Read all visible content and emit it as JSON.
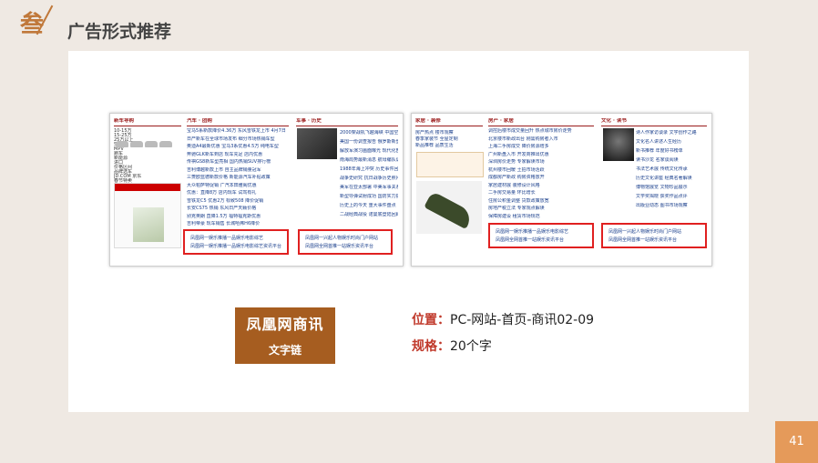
{
  "header": {
    "section_number": "叁",
    "section_title": "广告形式推荐"
  },
  "screenshot_left": {
    "col1_heading": "新车导购",
    "col1_lines": [
      "10-15万",
      "15-25万",
      "25万以上",
      "SUV",
      "MPV",
      "跑车",
      "新能源",
      "进口",
      "价格区间",
      "品牌选车",
      "JD.COM 京东",
      "春节特卖"
    ],
    "col2_heading": "汽车 · 团购",
    "col2_lines": [
      "宝马5系新款降价4.36万 东风雪铁龙上市 4月7日",
      "日产新车在全球市场发布 细分市场热销车型",
      "奥迪A4最新优惠 宝马3系优惠4.5万 纯电车型",
      "奔驰GLK新车到店 现车充足 店内优惠",
      "传祺GS8新车型亮相 国内热销SUV排行榜",
      "吉利博越新款上市 自主品牌销量冠军",
      "三菱欧蓝德新款价格 新能源汽车补贴政策",
      "大众帕萨特促销 广汽本田雅阁优惠",
      "优惠：直降8万 店内现车 试驾有礼",
      "雪铁龙C5 优惠2万 标致508 降价促销",
      "长安CS75 热销 东风日产天籁价格",
      "别克英朗 直降1.5万 福特福克斯优惠",
      "吉利帝豪 现车销售 长城哈弗H6降价"
    ],
    "col3_heading": "军事 · 历史",
    "col3_lines": [
      "2000架战机飞越海峡 中国空军展示实力",
      "美国一份调查报告 俄罗斯新型战机",
      "解放军演习画面曝光 现代化部队建设",
      "南海局势最新消息 航母编队训练",
      "1988年海上冲突 历史事件回顾",
      "战争史研究 抗日战争历史照片",
      "美军在亚太部署 中美军事关系",
      "新型导弹试射成功 国防实力提升",
      "历史上的今天 重大事件盘点",
      "二战经典战役 诺曼底登陆回顾"
    ],
    "ad_text_1": "凤凰网一娱乐推播一品娱乐电影综艺",
    "ad_text_2": "凤凰网一娱乐推播一品娱乐电影综艺资讯平台",
    "ad_text_3": "凤凰网一兴起人物娱乐时尚门户网站",
    "ad_text_4": "凤凰网全网首推一站娱乐资讯平台"
  },
  "screenshot_right": {
    "col1_heading": "家居 · 装修",
    "col1_lines": [
      "房产热点 楼市观察",
      "春季家装节 全屋定制",
      "新品推荐 品质生活"
    ],
    "col2_heading": "房产 · 家居",
    "col2_lines": [
      "调控后楼市成交量回升 热点城市房价走势",
      "北京楼市新政出台 刚需购房者入市",
      "上海二手房成交 降价房源增多",
      "广州新盘入市 开发商推出优惠",
      "深圳房价走势 专家解读市场",
      "杭州楼市回暖 土拍市场活跃",
      "成都房产新政 购房资格放开",
      "家居建材展 装修设计风格",
      "二手房交易量 环比增长",
      "住房公积金调整 贷款政策放宽",
      "房地产税立法 专家观点解读",
      "保障房建设 租赁市场规范"
    ],
    "col3_heading": "文化 · 读书",
    "col3_lines": [
      "诗人作家访谈录 文学创作之路",
      "文化名人讲述人生经历",
      "新书推荐 年度好书榜单",
      "读书沙龙 名家谈阅读",
      "书法艺术展 传统文化传承",
      "历史文化讲座 经典名著解读",
      "博物馆展览 文物珍品展示",
      "文学奖揭晓 获奖作品点评",
      "出版业动态 图书市场观察"
    ],
    "ad_text_1": "凤凰网一娱乐推播一品娱乐电影综艺",
    "ad_text_2": "凤凰网全网首推一站娱乐资讯平台",
    "ad_text_3": "凤凰网一兴起人物娱乐时尚门户网站",
    "ad_text_4": "凤凰网全网首推一站娱乐资讯平台"
  },
  "ad_badge": {
    "title": "凤凰网商讯",
    "subtitle": "文字链"
  },
  "info": {
    "position_label": "位置：",
    "position_value": "PC-网站-首页-商讯02-09",
    "spec_label": "规格：",
    "spec_value": "20个字"
  },
  "page_number": "41",
  "colors": {
    "accent": "#c0783a",
    "badge": "#a65d20",
    "highlight_box": "#e02020",
    "label_red": "#c0392b",
    "page_tab": "#e59a5a"
  }
}
